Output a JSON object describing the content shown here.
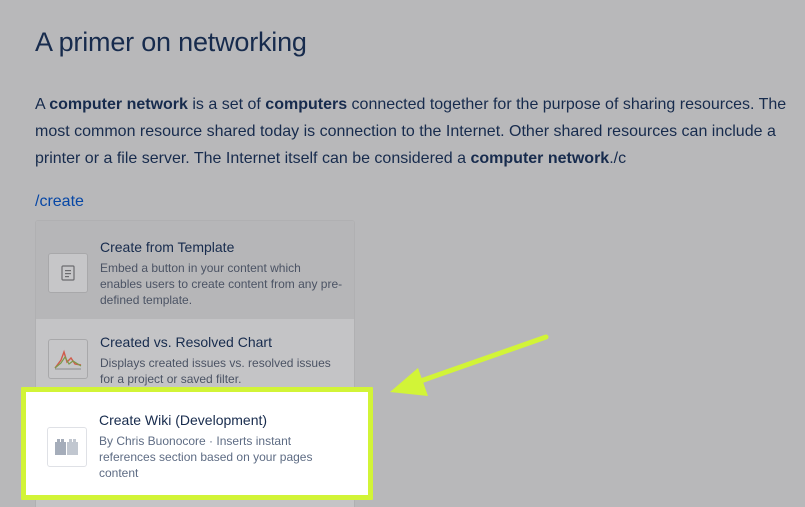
{
  "page": {
    "title": "A primer on networking"
  },
  "paragraph": {
    "s1": "A ",
    "s2": "computer network",
    "s3": " is a set of ",
    "s4": "computers",
    "s5": " connected together for the purpose of sharing resources. The most common resource shared today is connection to the Internet. Other shared resources can include a printer or a file server. The Internet itself can be considered a ",
    "s6": "computer network",
    "s7": "./c"
  },
  "command": {
    "text": "/create"
  },
  "menu": {
    "items": [
      {
        "icon": "template-document-icon",
        "title": "Create from Template",
        "description": "Embed a button in your content which enables users to create content from any pre-defined template."
      },
      {
        "icon": "line-chart-icon",
        "title": "Created vs. Resolved Chart",
        "description": "Displays created issues vs. resolved issues for a project or saved filter."
      },
      {
        "icon": "wiki-blocks-icon",
        "title": "Create Wiki (Development)",
        "description": "By Chris Buonocore · Inserts instant references section based on your pages content"
      }
    ]
  },
  "colors": {
    "highlight": "#d2f437",
    "link": "#0747a6",
    "text": "#172b4d"
  }
}
